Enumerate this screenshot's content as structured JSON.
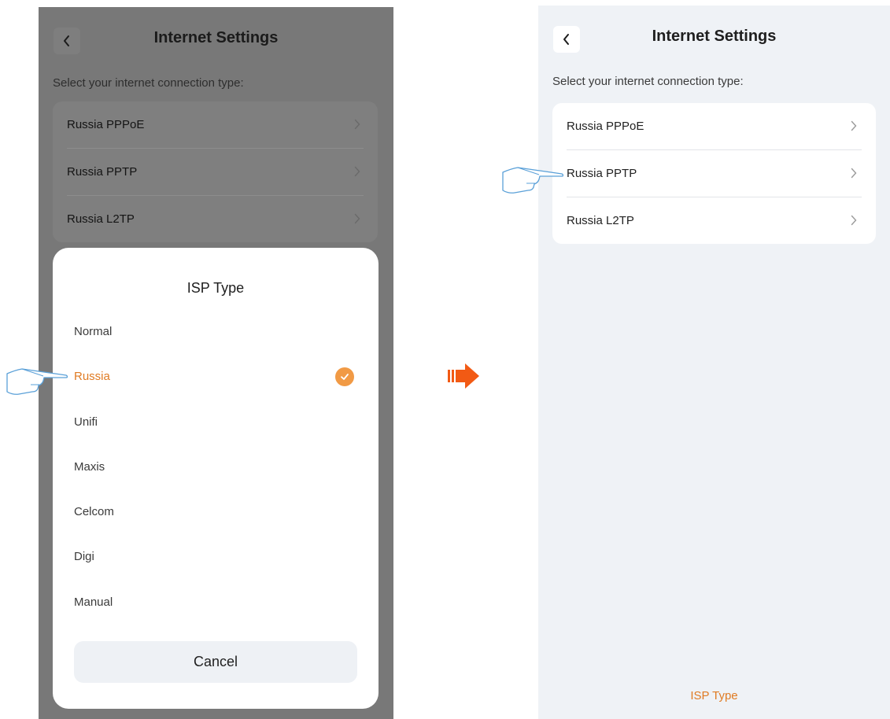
{
  "left_screen": {
    "header": {
      "title": "Internet Settings",
      "back_icon": "chevron-left-icon"
    },
    "subtitle": "Select your internet connection type:",
    "connection_types": [
      {
        "label": "Russia PPPoE"
      },
      {
        "label": "Russia PPTP"
      },
      {
        "label": "Russia L2TP"
      }
    ],
    "isp_sheet": {
      "title": "ISP Type",
      "options": [
        {
          "label": "Normal",
          "selected": false
        },
        {
          "label": "Russia",
          "selected": true
        },
        {
          "label": "Unifi",
          "selected": false
        },
        {
          "label": "Maxis",
          "selected": false
        },
        {
          "label": "Celcom",
          "selected": false
        },
        {
          "label": "Digi",
          "selected": false
        },
        {
          "label": "Manual",
          "selected": false
        }
      ],
      "cancel_label": "Cancel",
      "check_icon": "check-circle-icon"
    }
  },
  "transition_icon": "arrow-right-icon",
  "right_screen": {
    "header": {
      "title": "Internet Settings",
      "back_icon": "chevron-left-icon"
    },
    "subtitle": "Select your internet connection type:",
    "connection_types": [
      {
        "label": "Russia PPPoE"
      },
      {
        "label": "Russia PPTP"
      },
      {
        "label": "Russia L2TP"
      }
    ],
    "footer_link": "ISP Type"
  },
  "pointer_icon": "pointing-hand-icon",
  "colors": {
    "accent": "#e07b23",
    "check": "#f19a45",
    "arrow": "#f25a14",
    "overlay": "#787878",
    "page_bg": "#eff2f6",
    "hand_outline": "#5aa0d8"
  }
}
